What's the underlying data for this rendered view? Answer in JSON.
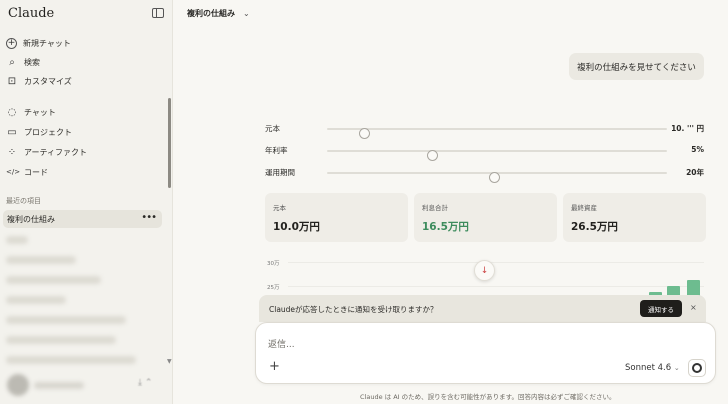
{
  "sidebar": {
    "brand": "Claude",
    "nav": [
      {
        "icon": "+",
        "label": "新規チャット"
      },
      {
        "icon": "⌕",
        "label": "検索"
      },
      {
        "icon": "⊡",
        "label": "カスタマイズ"
      },
      {
        "icon": "◌",
        "label": "チャット"
      },
      {
        "icon": "▭",
        "label": "プロジェクト"
      },
      {
        "icon": "⁘",
        "label": "アーティファクト"
      },
      {
        "icon": "</>",
        "label": "コード"
      }
    ],
    "recents_label": "最近の項目",
    "active_recent": "複利の仕組み",
    "active_more": "•••"
  },
  "header": {
    "title": "複利の仕組み",
    "chevron": "⌄"
  },
  "user_message": "複利の仕組みを見せてください",
  "sliders": [
    {
      "label": "元本",
      "value": "10. ''' 円",
      "position": 0.11
    },
    {
      "label": "年利率",
      "value": "5%",
      "position": 0.31
    },
    {
      "label": "運用期間",
      "value": "20年",
      "position": 0.49
    }
  ],
  "cards": [
    {
      "title": "元本",
      "value": "10.0万円",
      "color": "#23221f"
    },
    {
      "title": "利息合計",
      "value": "16.5万円",
      "color": "#3d8c5d"
    },
    {
      "title": "最終資産",
      "value": "26.5万円",
      "color": "#23221f"
    }
  ],
  "chart": {
    "ticks": [
      "30万",
      "25万"
    ]
  },
  "notification": {
    "message": "Claudeが応答したときに通知を受け取りますか？",
    "button": "通知する",
    "close": "×"
  },
  "composer": {
    "placeholder": "返信...",
    "plus": "+",
    "model": "Sonnet 4.6",
    "model_chev": "⌄"
  },
  "disclaimer": "Claude は AI のため、誤りを含む可能性があります。回答内容は必ずご確認ください。",
  "colors": {
    "accent_green": "#3d8c5d",
    "bar_green": "#6dbc8f",
    "background": "#f8f7f3",
    "sidebar": "#f3f2ed"
  }
}
